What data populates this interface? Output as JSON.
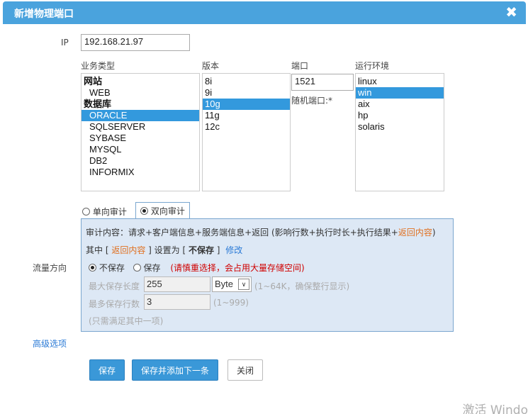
{
  "dialog": {
    "title": "新增物理端口",
    "close_icon": "✖"
  },
  "ip": {
    "label": "IP",
    "value": "192.168.21.97"
  },
  "business_type": {
    "label": "业务类型",
    "options": [
      {
        "text": "网站",
        "kind": "group"
      },
      {
        "text": "WEB",
        "kind": "item"
      },
      {
        "text": "数据库",
        "kind": "group"
      },
      {
        "text": "ORACLE",
        "kind": "item",
        "selected": true
      },
      {
        "text": "SQLSERVER",
        "kind": "item"
      },
      {
        "text": "SYBASE",
        "kind": "item"
      },
      {
        "text": "MYSQL",
        "kind": "item"
      },
      {
        "text": "DB2",
        "kind": "item"
      },
      {
        "text": "INFORMIX",
        "kind": "item"
      }
    ]
  },
  "version": {
    "label": "版本",
    "options": [
      {
        "text": "8i"
      },
      {
        "text": "9i"
      },
      {
        "text": "10g",
        "selected": true
      },
      {
        "text": "11g"
      },
      {
        "text": "12c"
      }
    ]
  },
  "port": {
    "label": "端口",
    "value": "1521",
    "random_label": "随机端口:*"
  },
  "runtime_env": {
    "label": "运行环境",
    "options": [
      {
        "text": "linux"
      },
      {
        "text": "win",
        "selected": true
      },
      {
        "text": "aix"
      },
      {
        "text": "hp"
      },
      {
        "text": "solaris"
      }
    ]
  },
  "audit_mode": {
    "one_way": "单向审计",
    "two_way": "双向审计",
    "selected": "two_way"
  },
  "flow_direction_label": "流量方向",
  "audit_panel": {
    "content_prefix": "审计内容：请求+客户端信息+服务端信息+返回 (影响行数+执行时长+执行结果+",
    "content_highlight": "返回内容",
    "content_suffix": ")",
    "setting_prefix": "其中 [ ",
    "setting_highlight": "返回内容",
    "setting_mid": " ] 设置为 [ ",
    "setting_value": "不保存",
    "setting_end": " ]",
    "modify_link": "修改",
    "no_save_label": "不保存",
    "save_label": "保存",
    "save_warning": "(请慎重选择，会占用大量存储空间)",
    "max_len_label": "最大保存长度",
    "max_len_value": "255",
    "unit_value": "Byte",
    "max_len_hint": "(1~64K，确保整行显示)",
    "max_rows_label": "最多保存行数",
    "max_rows_value": "3",
    "max_rows_hint": "(1~999)",
    "satisfy_hint": "(只需满足其中一项)"
  },
  "advanced_link": "高级选项",
  "buttons": {
    "save": "保存",
    "save_and_add": "保存并添加下一条",
    "close": "关闭"
  },
  "watermark": "激活 Windo"
}
